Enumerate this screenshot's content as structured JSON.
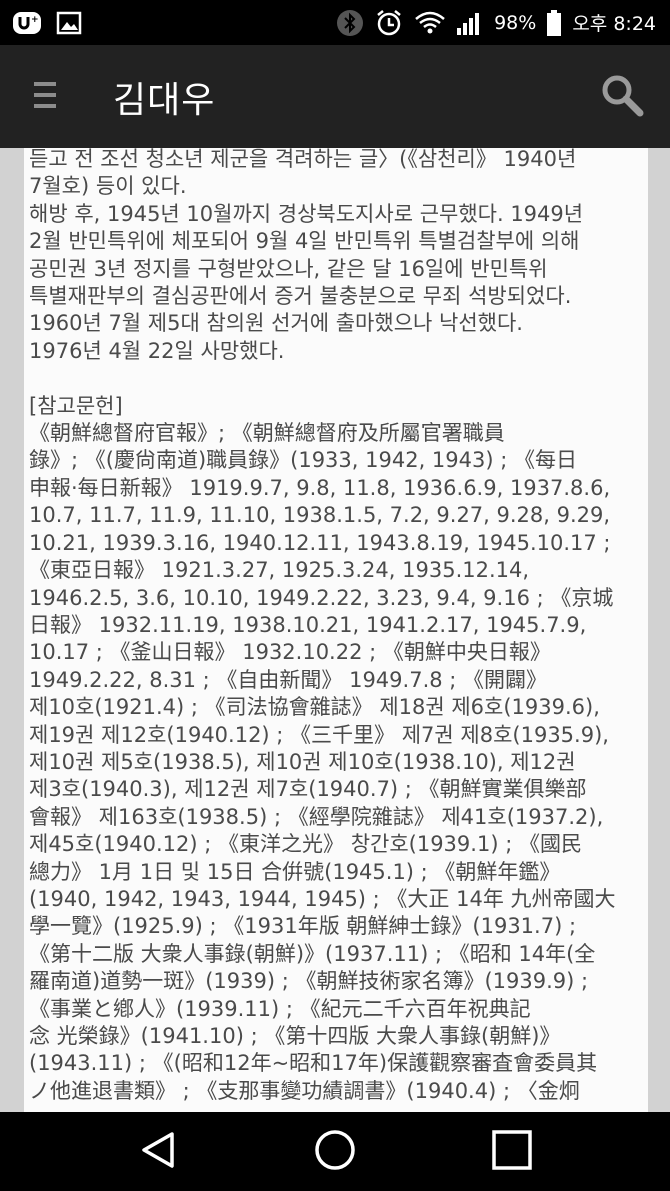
{
  "status_bar": {
    "battery_percent": "98%",
    "time": "오후 8:24",
    "icons": [
      "u-plus-logo-icon",
      "image-notification-icon",
      "bluetooth-icon",
      "alarm-icon",
      "wifi-icon",
      "signal-icon",
      "battery-icon"
    ]
  },
  "app_bar": {
    "title": "김대우",
    "icons": [
      "hamburger-menu-icon",
      "search-icon"
    ]
  },
  "article": {
    "lines": [
      "듣고 전 조선 청소년 제군을 격려하는 글〉(《삼천리》 1940년",
      "7월호) 등이 있다.",
      "해방 후, 1945년 10월까지 경상북도지사로 근무했다. 1949년",
      "2월 반민특위에 체포되어 9월 4일 반민특위 특별검찰부에 의해",
      "공민권 3년 정지를 구형받았으나, 같은 달 16일에 반민특위",
      "특별재판부의 결심공판에서 증거 불충분으로 무죄 석방되었다.",
      "1960년 7월 제5대 참의원 선거에 출마했으나 낙선했다.",
      "1976년 4월 22일 사망했다.",
      "",
      "[참고문헌]",
      "《朝鮮總督府官報》; 《朝鮮總督府及所屬官署職員",
      "錄》; 《(慶尙南道)職員錄》(1933, 1942, 1943) ; 《每日",
      "申報·每日新報》 1919.9.7, 9.8, 11.8, 1936.6.9, 1937.8.6,",
      "10.7, 11.7, 11.9, 11.10, 1938.1.5, 7.2, 9.27, 9.28, 9.29,",
      "10.21, 1939.3.16, 1940.12.11, 1943.8.19, 1945.10.17 ;",
      "《東亞日報》 1921.3.27, 1925.3.24, 1935.12.14,",
      "1946.2.5, 3.6, 10.10, 1949.2.22, 3.23, 9.4, 9.16 ; 《京城",
      "日報》 1932.11.19, 1938.10.21, 1941.2.17, 1945.7.9,",
      "10.17 ; 《釜山日報》 1932.10.22 ; 《朝鮮中央日報》",
      "1949.2.22, 8.31 ; 《自由新聞》 1949.7.8 ; 《開闢》",
      "제10호(1921.4) ; 《司法協會雜誌》 제18권 제6호(1939.6),",
      "제19권 제12호(1940.12) ; 《三千里》 제7권 제8호(1935.9),",
      "제10권 제5호(1938.5), 제10권 제10호(1938.10), 제12권",
      "제3호(1940.3), 제12권 제7호(1940.7) ; 《朝鮮實業俱樂部",
      "會報》 제163호(1938.5) ; 《經學院雜誌》 제41호(1937.2),",
      "제45호(1940.12) ; 《東洋之光》 창간호(1939.1) ; 《國民",
      "總力》 1月 1日 및 15日 合倂號(1945.1) ; 《朝鮮年鑑》",
      "(1940, 1942, 1943, 1944, 1945) ; 《大正 14年 九州帝國大",
      "學一覽》(1925.9) ; 《1931年版 朝鮮紳士錄》(1931.7) ;",
      "《第十二版 大衆人事錄(朝鮮)》(1937.11) ; 《昭和 14年(全",
      "羅南道)道勢一斑》(1939) ; 《朝鮮技術家名簿》(1939.9) ;",
      "《事業と鄕人》(1939.11) ; 《紀元二千六百年祝典記",
      "念 光榮錄》(1941.10) ; 《第十四版 大衆人事錄(朝鮮)》",
      "(1943.11) ; 《(昭和12年~昭和17年)保護觀察審査會委員其",
      "ノ他進退書類》 ; 《支那事變功績調書》(1940.4) ; 〈金炯"
    ]
  },
  "nav_bar": {
    "icons": [
      "back-icon",
      "home-icon",
      "recents-icon"
    ]
  }
}
